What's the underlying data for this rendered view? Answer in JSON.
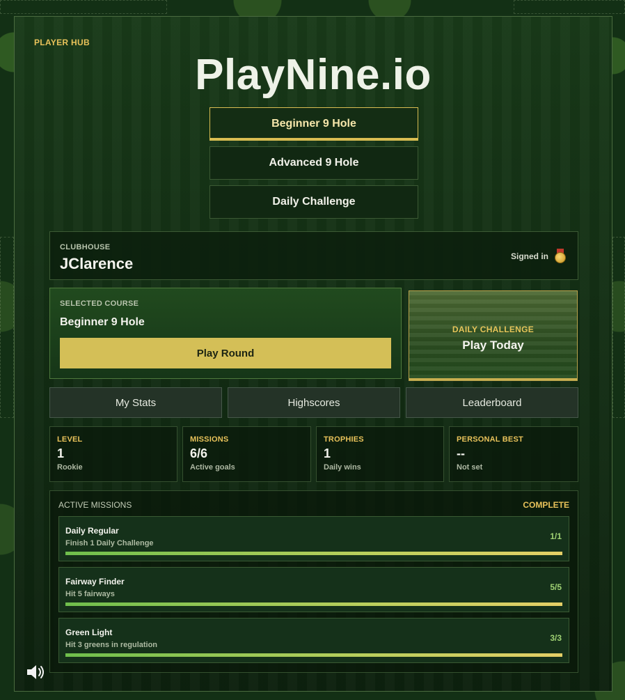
{
  "hub_tag": "PLAYER HUB",
  "app_title": "PlayNine.io",
  "modes": [
    {
      "label": "Beginner 9 Hole",
      "active": true
    },
    {
      "label": "Advanced 9 Hole",
      "active": false
    },
    {
      "label": "Daily Challenge",
      "active": false
    }
  ],
  "clubhouse": {
    "label": "CLUBHOUSE",
    "username": "JClarence",
    "status": "Signed in",
    "status_icon": "medal-icon"
  },
  "selected_course": {
    "label": "SELECTED COURSE",
    "name": "Beginner 9 Hole",
    "play_label": "Play Round"
  },
  "daily_challenge": {
    "label": "DAILY CHALLENGE",
    "action": "Play Today"
  },
  "nav": [
    "My Stats",
    "Highscores",
    "Leaderboard"
  ],
  "stats": [
    {
      "label": "LEVEL",
      "value": "1",
      "sub": "Rookie"
    },
    {
      "label": "MISSIONS",
      "value": "6/6",
      "sub": "Active goals"
    },
    {
      "label": "TROPHIES",
      "value": "1",
      "sub": "Daily wins"
    },
    {
      "label": "PERSONAL BEST",
      "value": "--",
      "sub": "Not set"
    }
  ],
  "missions": {
    "heading": "ACTIVE MISSIONS",
    "status": "COMPLETE",
    "items": [
      {
        "title": "Daily Regular",
        "desc": "Finish 1 Daily Challenge",
        "count": "1/1",
        "progress": 1.0
      },
      {
        "title": "Fairway Finder",
        "desc": "Hit 5 fairways",
        "count": "5/5",
        "progress": 1.0
      },
      {
        "title": "Green Light",
        "desc": "Hit 3 greens in regulation",
        "count": "3/3",
        "progress": 1.0
      }
    ]
  },
  "sound_icon": "speaker-icon",
  "colors": {
    "accent_gold": "#d4bf57",
    "panel_green": "#193a19",
    "progress_green": "#6fbf4c"
  }
}
